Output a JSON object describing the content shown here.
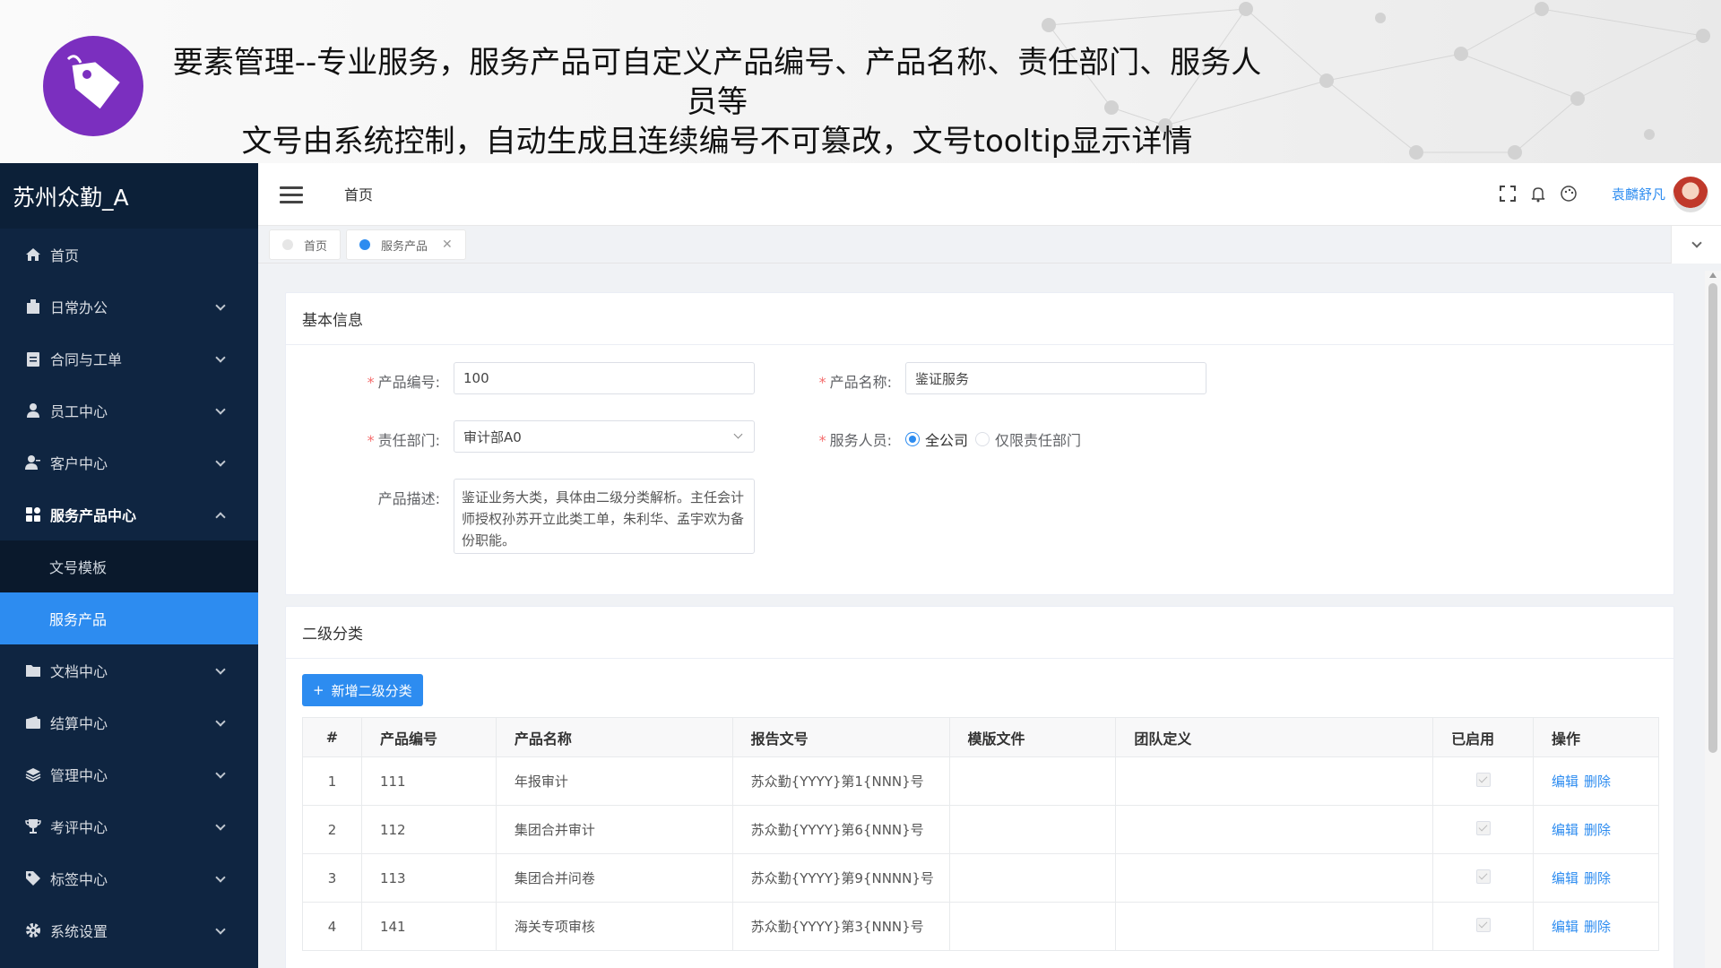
{
  "banner": {
    "line1": "要素管理--专业服务，服务产品可自定义产品编号、产品名称、责任部门、服务人员等",
    "line2": "文号由系统控制，自动生成且连续编号不可篡改，文号tooltip显示详情"
  },
  "sidebar": {
    "title": "苏州众勤_A",
    "items": [
      {
        "label": "首页",
        "icon": "home-icon"
      },
      {
        "label": "日常办公",
        "icon": "building-icon"
      },
      {
        "label": "合同与工单",
        "icon": "clipboard-icon"
      },
      {
        "label": "员工中心",
        "icon": "user-icon"
      },
      {
        "label": "客户中心",
        "icon": "users-icon"
      },
      {
        "label": "服务产品中心",
        "icon": "apps-icon"
      },
      {
        "label": "文号模板",
        "icon": ""
      },
      {
        "label": "服务产品",
        "icon": ""
      },
      {
        "label": "文档中心",
        "icon": "folder-icon"
      },
      {
        "label": "结算中心",
        "icon": "wallet-icon"
      },
      {
        "label": "管理中心",
        "icon": "layers-icon"
      },
      {
        "label": "考评中心",
        "icon": "trophy-icon"
      },
      {
        "label": "标签中心",
        "icon": "tag-icon"
      },
      {
        "label": "系统设置",
        "icon": "gear-icon"
      }
    ]
  },
  "header": {
    "home": "首页",
    "user": "袁麟舒凡"
  },
  "tabs": [
    {
      "label": "首页"
    },
    {
      "label": "服务产品"
    }
  ],
  "basic": {
    "title": "基本信息",
    "code_label": "产品编号:",
    "code_value": "100",
    "name_label": "产品名称:",
    "name_value": "鉴证服务",
    "dept_label": "责任部门:",
    "dept_value": "审计部A0",
    "staff_label": "服务人员:",
    "staff_opt1": "全公司",
    "staff_opt2": "仅限责任部门",
    "desc_label": "产品描述:",
    "desc_value": "鉴证业务大类，具体由二级分类解析。主任会计师授权孙苏开立此类工单，朱利华、孟宇欢为备份职能。"
  },
  "secondary": {
    "title": "二级分类",
    "add_button": "新增二级分类",
    "columns": [
      "#",
      "产品编号",
      "产品名称",
      "报告文号",
      "模版文件",
      "团队定义",
      "已启用",
      "操作"
    ],
    "rows": [
      {
        "idx": "1",
        "code": "111",
        "name": "年报审计",
        "doc": "苏众勤{YYYY}第1{NNN}号",
        "template": "",
        "team": "",
        "enabled": true
      },
      {
        "idx": "2",
        "code": "112",
        "name": "集团合并审计",
        "doc": "苏众勤{YYYY}第6{NNN}号",
        "template": "",
        "team": "",
        "enabled": true
      },
      {
        "idx": "3",
        "code": "113",
        "name": "集团合并问卷",
        "doc": "苏众勤{YYYY}第9{NNNN}号",
        "template": "",
        "team": "",
        "enabled": true
      },
      {
        "idx": "4",
        "code": "141",
        "name": "海关专项审核",
        "doc": "苏众勤{YYYY}第3{NNN}号",
        "template": "",
        "team": "",
        "enabled": true
      }
    ],
    "edit_label": "编辑",
    "delete_label": "删除"
  }
}
